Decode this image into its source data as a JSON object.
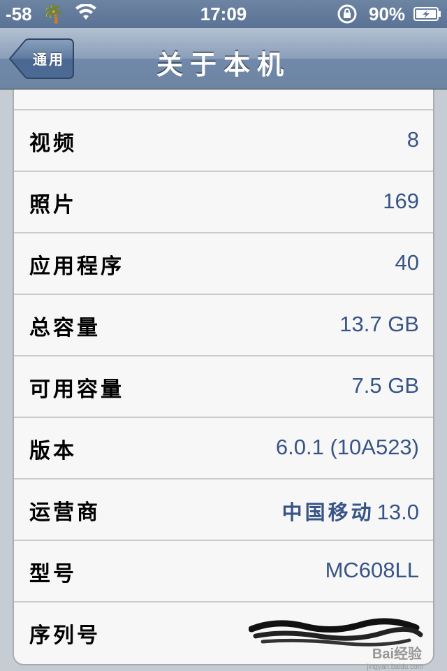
{
  "status_bar": {
    "signal": "-58",
    "time": "17:09",
    "battery": "90%",
    "carrier_icon": "palm-tree-icon",
    "icons": [
      "wifi-icon",
      "rotation-lock-icon",
      "battery-charging-icon"
    ]
  },
  "nav": {
    "back_label": "通用",
    "title": "关于本机"
  },
  "rows": [
    {
      "label": "",
      "value": ""
    },
    {
      "label": "视频",
      "value": "8"
    },
    {
      "label": "照片",
      "value": "169"
    },
    {
      "label": "应用程序",
      "value": "40"
    },
    {
      "label": "总容量",
      "value": "13.7 GB"
    },
    {
      "label": "可用容量",
      "value": "7.5 GB"
    },
    {
      "label": "版本",
      "value": "6.0.1 (10A523)"
    },
    {
      "label": "运营商",
      "value_cjk": "中国移动",
      "value": "13.0"
    },
    {
      "label": "型号",
      "value": "MC608LL"
    },
    {
      "label": "序列号",
      "value": "[redacted]"
    }
  ],
  "watermark": {
    "text": "Bai经验",
    "sub": "jingyan.baidu.com"
  },
  "colors": {
    "nav_blue": "#6d84a2",
    "value_blue": "#385487",
    "background": "#c5ccd4"
  }
}
